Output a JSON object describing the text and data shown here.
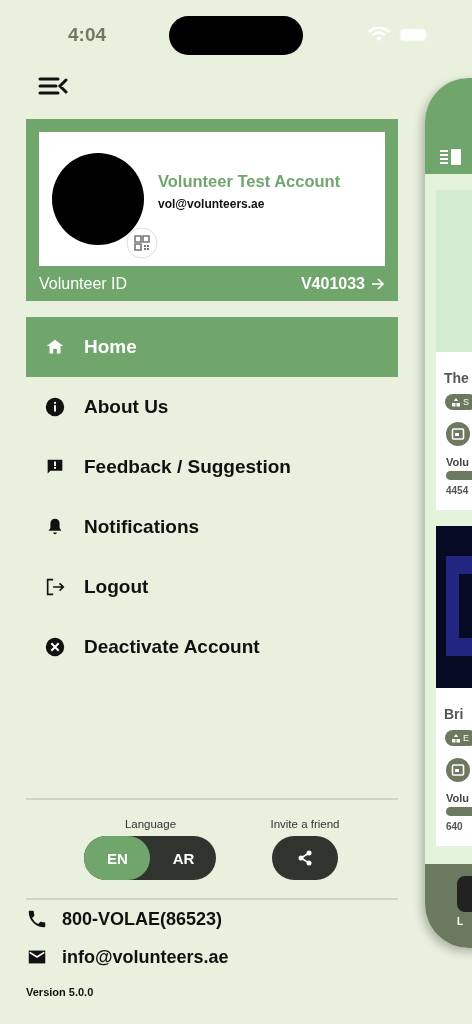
{
  "status_bar": {
    "time": "4:04"
  },
  "profile": {
    "name": "Volunteer Test Account",
    "email": "vol@volunteers.ae",
    "id_label": "Volunteer ID",
    "id_value": "V401033"
  },
  "menu": [
    {
      "label": "Home",
      "kind": "home",
      "selected": true
    },
    {
      "label": "About Us",
      "kind": "info",
      "selected": false
    },
    {
      "label": "Feedback / Suggestion",
      "kind": "feedback",
      "selected": false
    },
    {
      "label": "Notifications",
      "kind": "bell",
      "selected": false
    },
    {
      "label": "Logout",
      "kind": "logout",
      "selected": false
    },
    {
      "label": "Deactivate Account",
      "kind": "deactivate",
      "selected": false
    }
  ],
  "language": {
    "label": "Language",
    "options": [
      {
        "label": "EN",
        "selected": true
      },
      {
        "label": "AR",
        "selected": false
      }
    ]
  },
  "invite": {
    "label": "Invite a friend"
  },
  "contact": [
    {
      "kind": "phone",
      "text": "800-VOLAE(86523)"
    },
    {
      "kind": "email",
      "text": "info@volunteers.ae"
    }
  ],
  "version": "Version 5.0.0",
  "background_screen": {
    "cards": [
      {
        "kind": "blank",
        "title": "The",
        "tag": "S",
        "volume_label": "Volu",
        "count": "4454"
      },
      {
        "kind": "picture",
        "title": "Bri",
        "tag": "E",
        "volume_label": "Volu",
        "count": "640"
      }
    ],
    "nav_label": "L"
  }
}
